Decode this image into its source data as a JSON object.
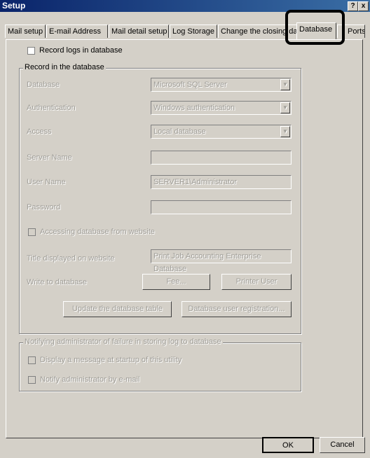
{
  "window": {
    "title": "Setup"
  },
  "titlebar_buttons": {
    "help": "?",
    "close": "x"
  },
  "tabs": [
    {
      "label": "Mail setup"
    },
    {
      "label": "E-mail Address"
    },
    {
      "label": "Mail detail setup"
    },
    {
      "label": "Log Storage"
    },
    {
      "label": "Change the closing date"
    },
    {
      "label": "Database"
    },
    {
      "label": "Ports"
    }
  ],
  "record_logs": {
    "label": "Record logs in database",
    "checked": false
  },
  "record_group": {
    "legend": "Record in the database",
    "database": {
      "label": "Database",
      "value": "Microsoft SQL Server"
    },
    "authentication": {
      "label": "Authentication",
      "value": "Windows authentication"
    },
    "access": {
      "label": "Access",
      "value": "Local database"
    },
    "server_name": {
      "label": "Server Name",
      "value": ""
    },
    "user_name": {
      "label": "User Name",
      "value": "SERVER1\\Administrator"
    },
    "password": {
      "label": "Password",
      "value": ""
    },
    "website_access": {
      "label": "Accessing database from website",
      "checked": false
    },
    "website_title": {
      "label": "Title displayed on website",
      "value": "Print Job Accounting Enterprise Database"
    },
    "write_label": "Write to database",
    "fee_button": "Fee...",
    "printer_user_button": "Printer User",
    "update_button": "Update the database table",
    "registration_button": "Database user registration..."
  },
  "notify_group": {
    "legend": "Notifying administrator of failure in storing log to database",
    "display_message": {
      "label": "Display a message at startup of this utility",
      "checked": false
    },
    "notify_email": {
      "label": "Notify administrator by e-mail",
      "checked": false
    }
  },
  "footer": {
    "ok": "OK",
    "cancel": "Cancel"
  }
}
